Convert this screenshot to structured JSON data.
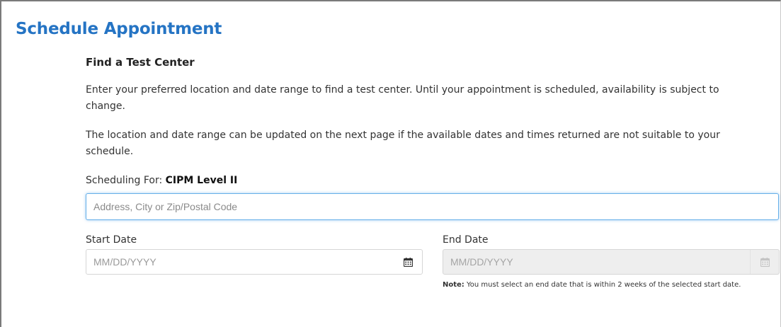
{
  "page": {
    "title": "Schedule Appointment"
  },
  "find_center": {
    "heading": "Find a Test Center",
    "paragraph_1": "Enter your preferred location and date range to find a test center. Until your appointment is scheduled, availability is subject to change.",
    "paragraph_2": "The location and date range can be updated on the next page if the available dates and times returned are not suitable to your schedule."
  },
  "scheduling_for": {
    "label": "Scheduling For: ",
    "value": "CIPM Level II"
  },
  "location": {
    "placeholder": "Address, City or Zip/Postal Code",
    "value": ""
  },
  "start_date": {
    "label": "Start Date",
    "placeholder": "MM/DD/YYYY",
    "icon": "calendar-icon"
  },
  "end_date": {
    "label": "End Date",
    "placeholder": "MM/DD/YYYY",
    "icon": "calendar-icon",
    "disabled": true
  },
  "note": {
    "label": "Note:",
    "text": " You must select an end date that is within 2 weeks of the selected start date."
  },
  "colors": {
    "title": "#2574c4",
    "focus_border": "#66afe9",
    "disabled_bg": "#eeeeee"
  }
}
